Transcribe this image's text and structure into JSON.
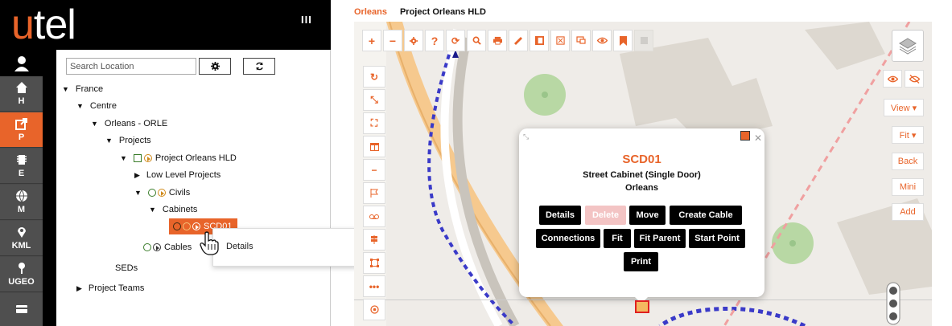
{
  "app": {
    "logo_first": "u",
    "logo_rest": "tel",
    "menu_toggle": "III"
  },
  "nav": {
    "items": [
      {
        "label": "H",
        "icon": "home-icon"
      },
      {
        "label": "P",
        "icon": "export-icon",
        "active": true
      },
      {
        "label": "E",
        "icon": "chip-icon"
      },
      {
        "label": "M",
        "icon": "globe-icon"
      },
      {
        "label": "KML",
        "icon": "map-pin-icon"
      },
      {
        "label": "UGEO",
        "icon": "pin-icon"
      },
      {
        "label": "",
        "icon": "card-icon"
      }
    ]
  },
  "tree": {
    "search_placeholder": "Search Location",
    "nodes": [
      {
        "label": "France"
      },
      {
        "label": "Centre"
      },
      {
        "label": "Orleans - ORLE"
      },
      {
        "label": "Projects"
      },
      {
        "label": "Project Orleans HLD"
      },
      {
        "label": "Low Level Projects"
      },
      {
        "label": "Civils"
      },
      {
        "label": "Cabinets"
      },
      {
        "label": "SCD01"
      },
      {
        "label": "Cables"
      },
      {
        "label": "SEDs"
      },
      {
        "label": "Project Teams"
      }
    ],
    "context_menu": {
      "item": "Details"
    }
  },
  "breadcrumb": {
    "first": "Orleans",
    "second": "Project Orleans HLD"
  },
  "right_panel": {
    "view": "View ▾",
    "fit": "Fit ▾",
    "back": "Back",
    "mini": "Mini",
    "add": "Add"
  },
  "popup": {
    "title": "SCD01",
    "type": "Street Cabinet (Single Door)",
    "location": "Orleans",
    "buttons": {
      "details": "Details",
      "delete": "Delete",
      "move": "Move",
      "create_cable": "Create Cable",
      "connections": "Connections",
      "fit": "Fit",
      "fit_parent": "Fit Parent",
      "start_point": "Start Point",
      "print": "Print"
    }
  },
  "colors": {
    "accent": "#e8642a",
    "nav_bg": "#4f4f4f"
  }
}
